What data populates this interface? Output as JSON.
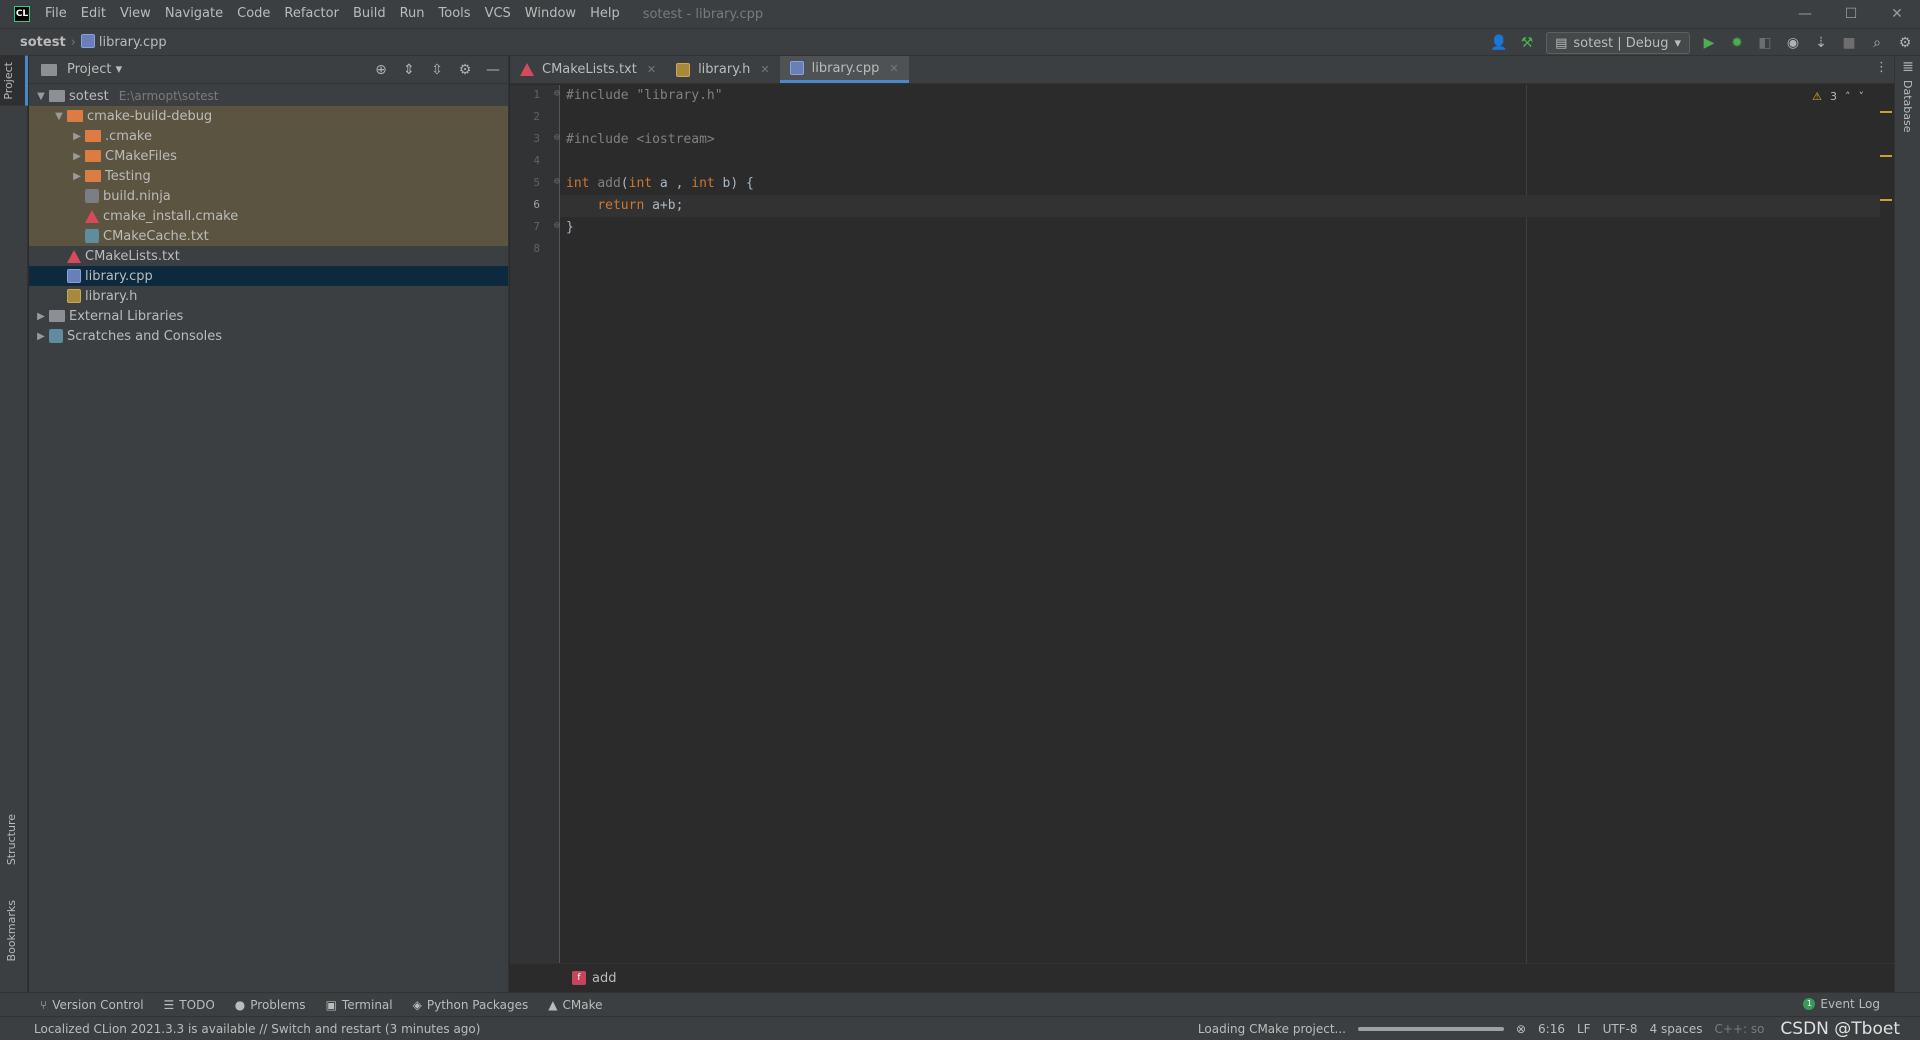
{
  "window": {
    "logo": "CL",
    "title": "sotest - library.cpp",
    "controls": [
      "—",
      "☐",
      "✕"
    ]
  },
  "menu": [
    "File",
    "Edit",
    "View",
    "Navigate",
    "Code",
    "Refactor",
    "Build",
    "Run",
    "Tools",
    "VCS",
    "Window",
    "Help"
  ],
  "navbar": {
    "root": "sotest",
    "file": "library.cpp",
    "run_config": "sotest | Debug"
  },
  "left_tabs": {
    "project": "Project",
    "structure": "Structure",
    "bookmarks": "Bookmarks"
  },
  "right_tabs": {
    "database": "Database"
  },
  "project_panel": {
    "title": "Project",
    "root": {
      "name": "sotest",
      "path": "E:\\armopt\\sotest"
    },
    "items": [
      {
        "name": "cmake-build-debug"
      },
      {
        "name": ".cmake"
      },
      {
        "name": "CMakeFiles"
      },
      {
        "name": "Testing"
      },
      {
        "name": "build.ninja"
      },
      {
        "name": "cmake_install.cmake"
      },
      {
        "name": "CMakeCache.txt"
      },
      {
        "name": "CMakeLists.txt"
      },
      {
        "name": "library.cpp"
      },
      {
        "name": "library.h"
      },
      {
        "name": "External Libraries"
      },
      {
        "name": "Scratches and Consoles"
      }
    ]
  },
  "editor": {
    "tabs": [
      {
        "label": "CMakeLists.txt"
      },
      {
        "label": "library.h"
      },
      {
        "label": "library.cpp"
      }
    ],
    "line_numbers": [
      "1",
      "2",
      "3",
      "4",
      "5",
      "6",
      "7",
      "8"
    ],
    "code": {
      "l1_directive": "#include",
      "l1_string": "\"library.h\"",
      "l3_directive": "#include",
      "l3_header": "<iostream>",
      "l5_kw1": "int",
      "l5_fn": "add",
      "l5_paren": "(",
      "l5_kw2": "int",
      "l5_param_a": " a , ",
      "l5_kw3": "int",
      "l5_rest": " b) {",
      "l6_kw": "return",
      "l6_rest": " a+b;",
      "l7": "}"
    },
    "warnings": "3",
    "breadcrumb_badge": "f",
    "breadcrumb_fn": "add"
  },
  "tool_windows": [
    "Version Control",
    "TODO",
    "Problems",
    "Terminal",
    "Python Packages",
    "CMake"
  ],
  "event_log": "Event Log",
  "status": {
    "message": "Localized CLion 2021.3.3 is available // Switch and restart (3 minutes ago)",
    "loading": "Loading CMake project...",
    "position": "6:16",
    "line_sep": "LF",
    "encoding": "UTF-8",
    "indent": "4 spaces",
    "lang": "C++: so",
    "watermark": "CSDN @Tboet"
  },
  "colors": {
    "accent": "#4a88c7",
    "excluded_bg": "#5b5440",
    "selected_bg": "#0d293e"
  }
}
